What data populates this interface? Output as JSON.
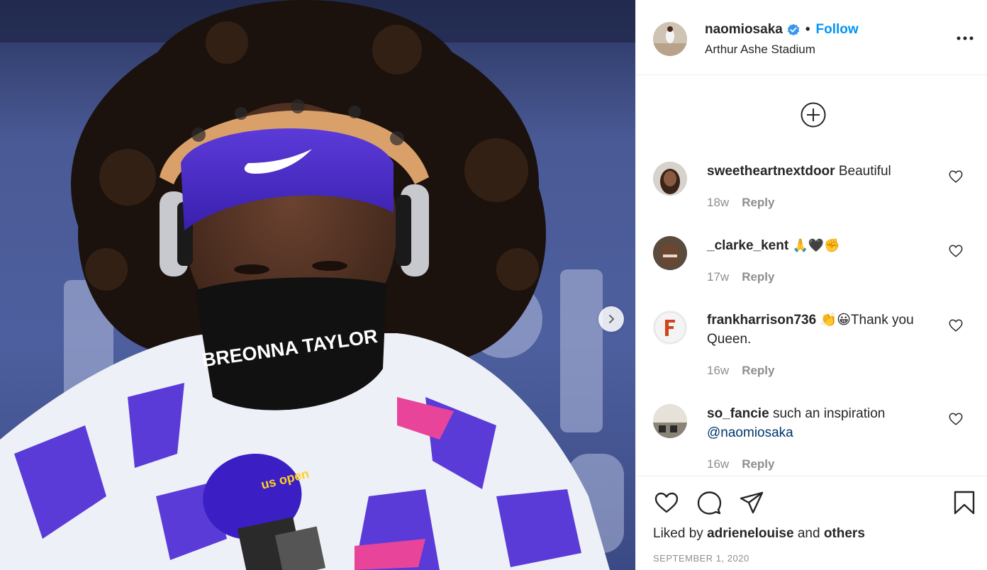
{
  "post": {
    "username": "naomiosaka",
    "separator": "•",
    "follow_label": "Follow",
    "location": "Arthur Ashe Stadium",
    "photo": {
      "visor_text": "BREONNA TAYLOR",
      "mic_text": "us open"
    }
  },
  "comments": [
    {
      "username": "sweetheartnextdoor",
      "text": "Beautiful",
      "mention": "",
      "time": "18w",
      "reply": "Reply"
    },
    {
      "username": "_clarke_kent",
      "text": "🙏🖤✊",
      "mention": "",
      "time": "17w",
      "reply": "Reply"
    },
    {
      "username": "frankharrison736",
      "text": "👏😀Thank you Queen.",
      "mention": "",
      "time": "16w",
      "reply": "Reply"
    },
    {
      "username": "so_fancie",
      "text": "such an inspiration",
      "mention": "@naomiosaka",
      "time": "16w",
      "reply": "Reply"
    }
  ],
  "likes": {
    "prefix": "Liked by",
    "user": "adrienelouise",
    "middle": "and",
    "others": "others"
  },
  "date": "SEPTEMBER 1, 2020",
  "colors": {
    "accent": "#0095f6",
    "text": "#262626",
    "muted": "#8e8e8e",
    "border": "#efefef"
  }
}
